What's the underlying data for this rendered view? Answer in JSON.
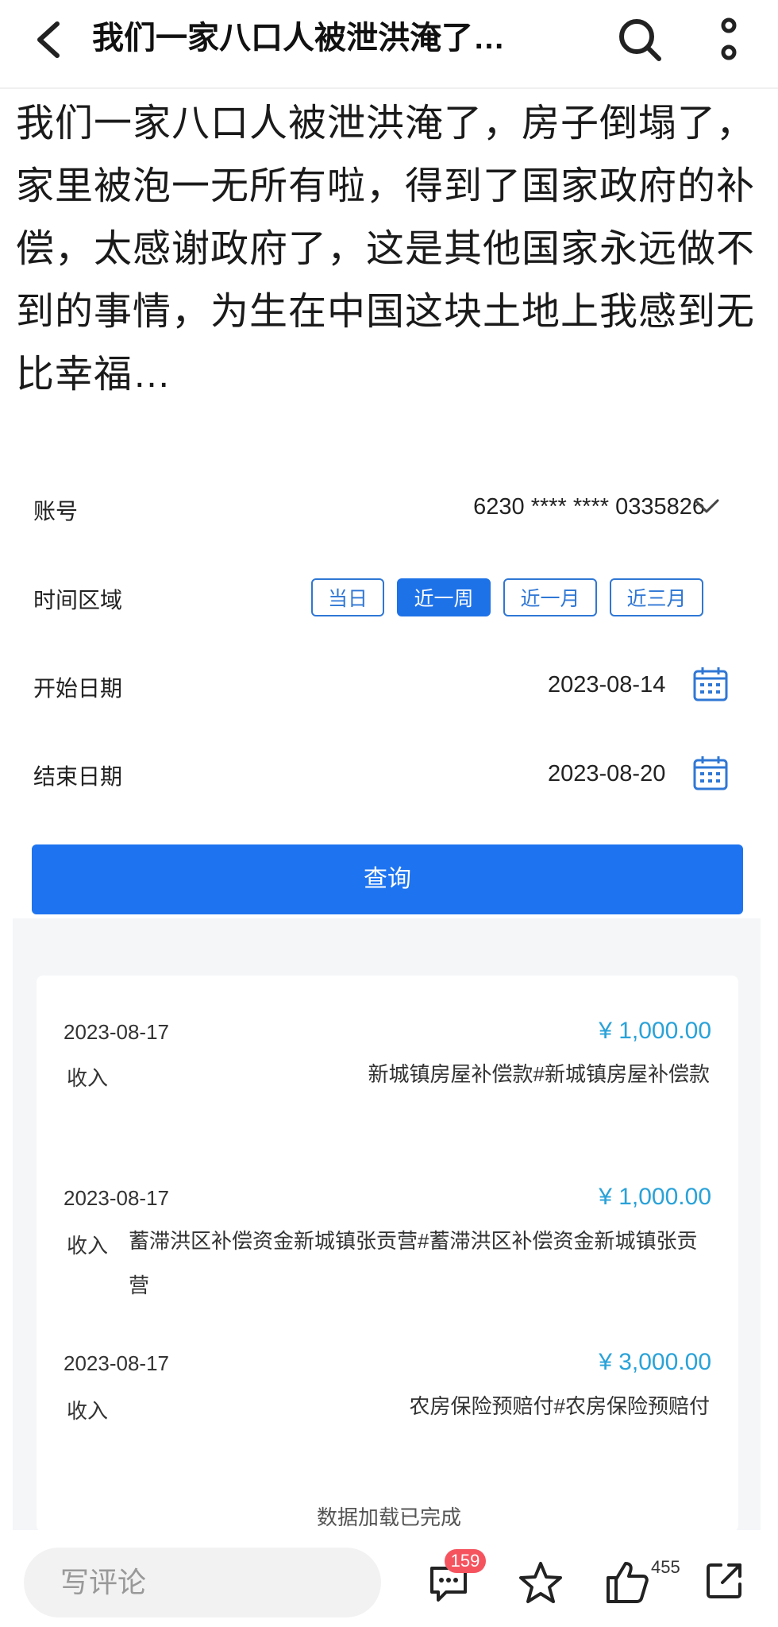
{
  "header": {
    "title": "我们一家八口人被泄洪淹了…"
  },
  "post": {
    "text": "我们一家八口人被泄洪淹了，房子倒塌了，家里被泡一无所有啦，得到了国家政府的补偿，太感谢政府了，这是其他国家永远做不到的事情，为生在中国这块土地上我感到无比幸福…"
  },
  "query_form": {
    "account_label": "账号",
    "account_value": "6230 **** **** 0335826",
    "period_label": "时间区域",
    "periods": [
      {
        "label": "当日",
        "active": false
      },
      {
        "label": "近一周",
        "active": true
      },
      {
        "label": "近一月",
        "active": false
      },
      {
        "label": "近三月",
        "active": false
      }
    ],
    "start_label": "开始日期",
    "start_value": "2023-08-14",
    "end_label": "结束日期",
    "end_value": "2023-08-20",
    "query_button": "查询"
  },
  "transactions": [
    {
      "date": "2023-08-17",
      "amount": "¥ 1,000.00",
      "type": "收入",
      "desc": "新城镇房屋补偿款#新城镇房屋补偿款"
    },
    {
      "date": "2023-08-17",
      "amount": "¥ 1,000.00",
      "type": "收入",
      "desc": "蓄滞洪区补偿资金新城镇张贡营#蓄滞洪区补偿资金新城镇张贡营"
    },
    {
      "date": "2023-08-17",
      "amount": "¥ 3,000.00",
      "type": "收入",
      "desc": "农房保险预赔付#农房保险预赔付"
    }
  ],
  "load_status": "数据加载已完成",
  "bottom_bar": {
    "comment_placeholder": "写评论",
    "comment_count": "159",
    "like_count": "455"
  },
  "colors": {
    "accent_blue": "#1e74f0",
    "amount_blue": "#2aa2d8",
    "badge_red": "#f5545f"
  }
}
